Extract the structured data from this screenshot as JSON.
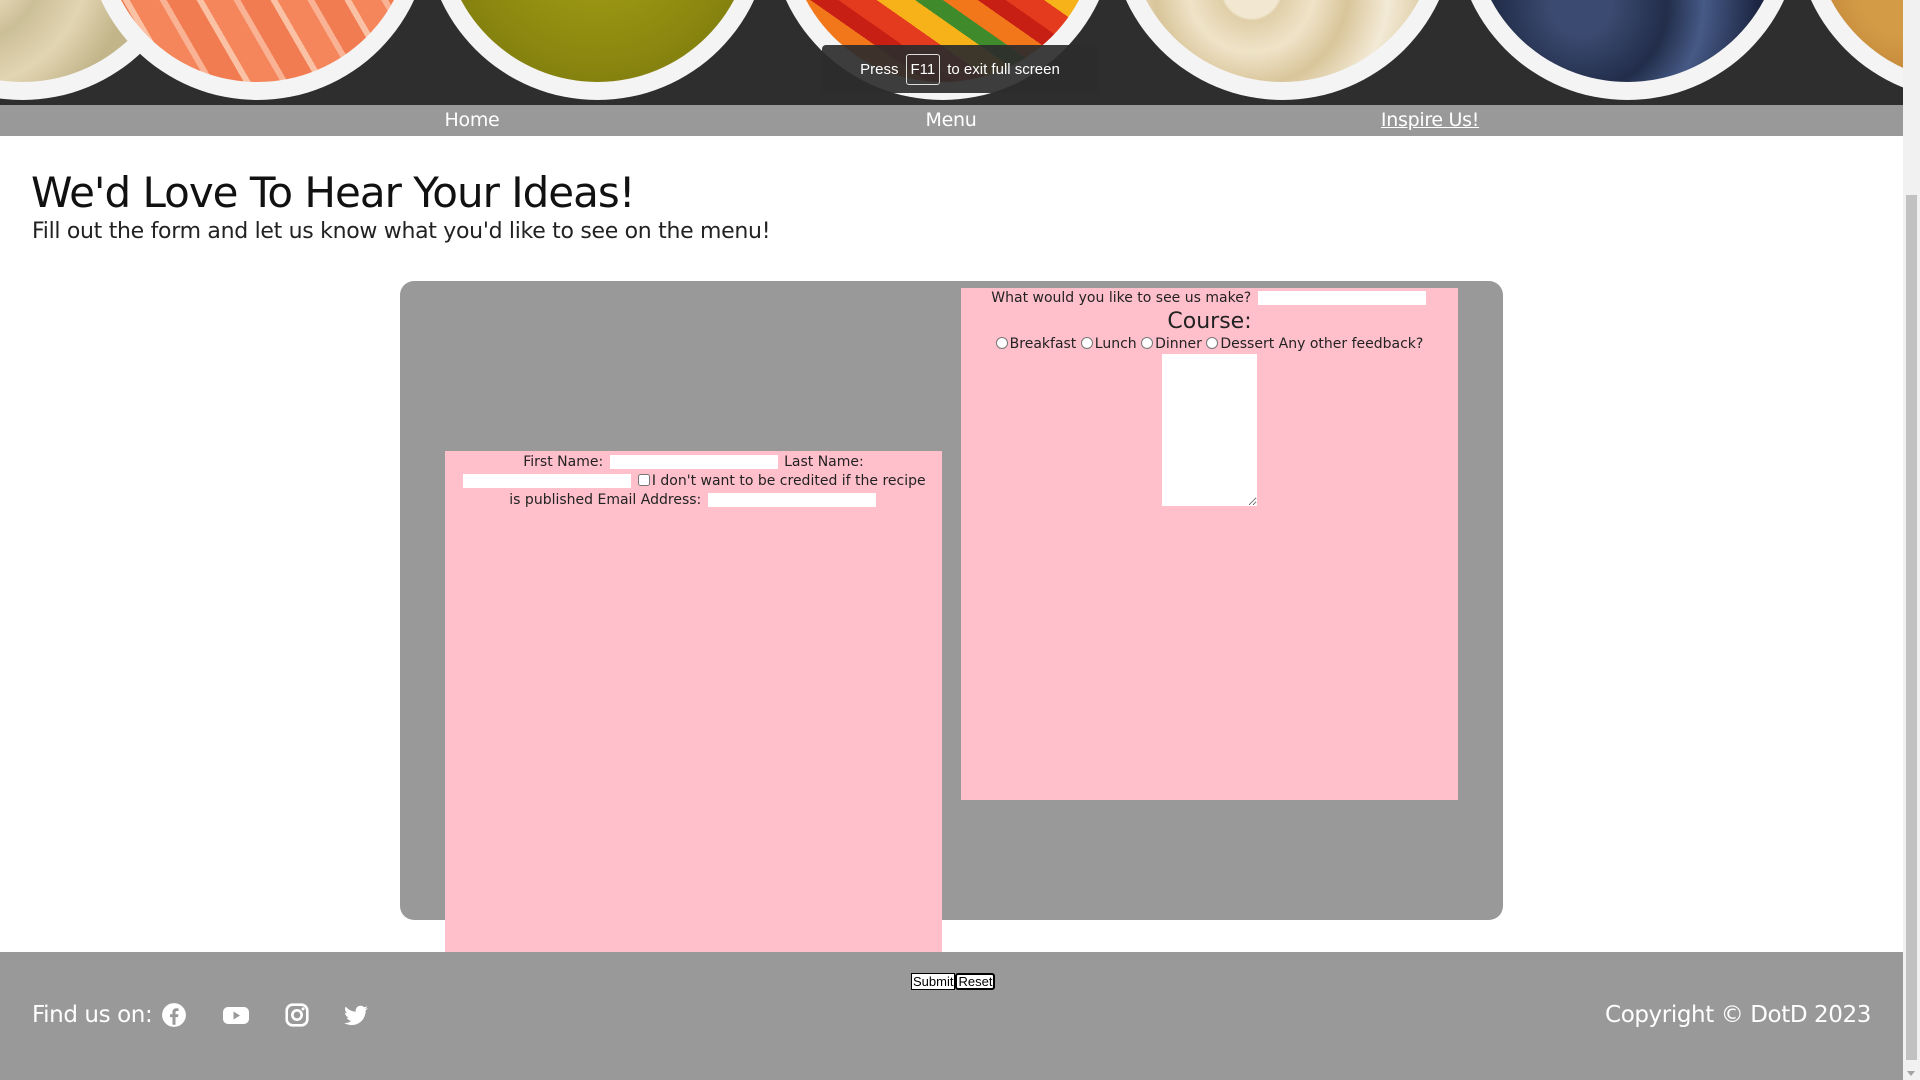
{
  "fullscreen_toast": {
    "press": "Press",
    "key": "F11",
    "suffix": "to exit full screen"
  },
  "nav": {
    "items": [
      {
        "label": "Home"
      },
      {
        "label": "Menu"
      },
      {
        "label": "Inspire Us!",
        "active": true
      }
    ]
  },
  "header": {
    "title": "We'd Love To Hear Your Ideas!",
    "subtitle": "Fill out the form and let us know what you'd like to see on the menu!"
  },
  "form": {
    "first_name_label": "First Name:",
    "first_name_value": "",
    "last_name_label": "Last Name:",
    "last_name_value": "",
    "credit_opt_out_label": "I don't want to be credited if the recipe is published",
    "email_label": "Email Address:",
    "email_value": "",
    "make_label": "What would you like to see us make?",
    "make_value": "",
    "course_label": "Course:",
    "courses": [
      "Breakfast",
      "Lunch",
      "Dinner",
      "Dessert"
    ],
    "feedback_label": "Any other feedback?",
    "feedback_value": "",
    "submit_label": "Submit",
    "reset_label": "Reset"
  },
  "footer": {
    "find_us_label": "Find us on:",
    "social_icons": [
      "facebook-icon",
      "youtube-icon",
      "instagram-icon",
      "twitter-icon"
    ],
    "copyright": "Copyright © DotD 2023"
  },
  "colors": {
    "nav_bg": "#999999",
    "form_panel": "#ffc0cb",
    "form_wrap": "#999999",
    "footer_bg": "#999999"
  }
}
